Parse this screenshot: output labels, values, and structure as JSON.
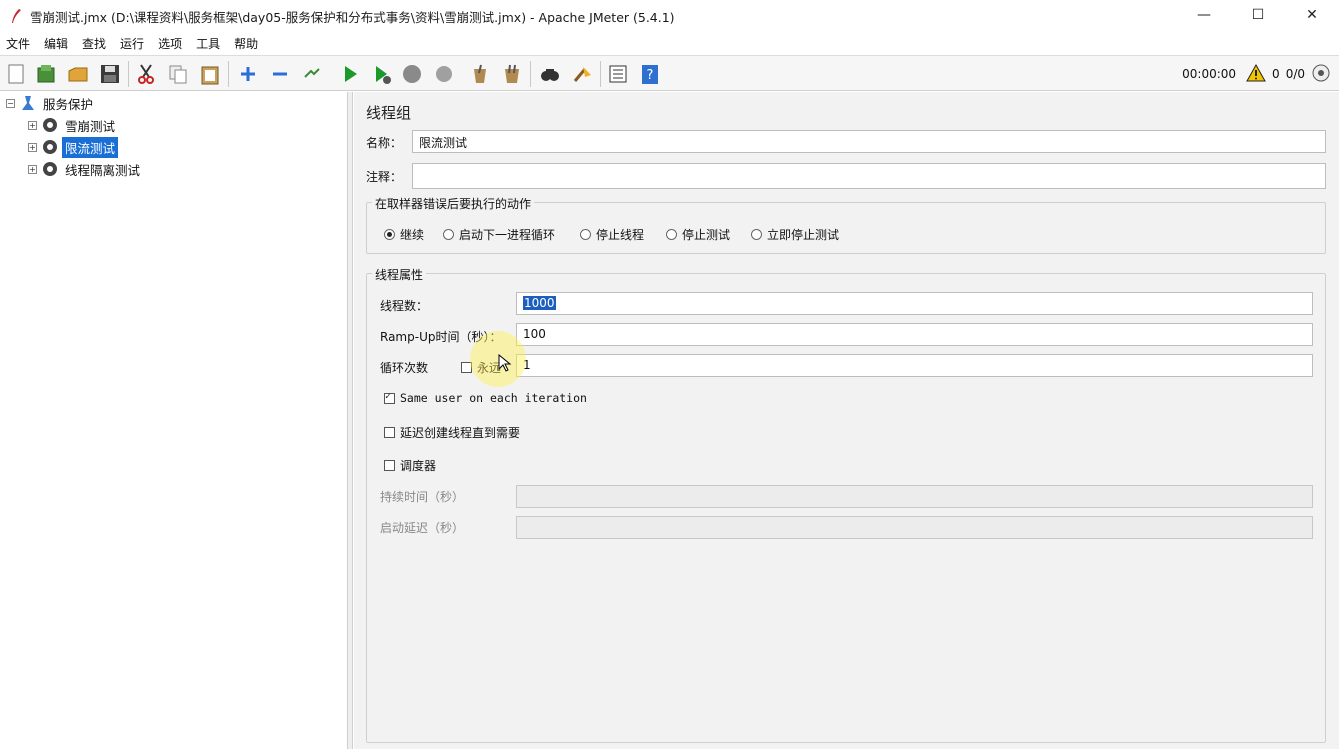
{
  "window": {
    "title": "雪崩测试.jmx (D:\\课程资料\\服务框架\\day05-服务保护和分布式事务\\资料\\雪崩测试.jmx) - Apache JMeter (5.4.1)",
    "controls": [
      "—",
      "☐",
      "✕"
    ]
  },
  "menu": [
    "文件",
    "编辑",
    "查找",
    "运行",
    "选项",
    "工具",
    "帮助"
  ],
  "toolbar": {
    "icons": [
      "new-icon",
      "templates-icon",
      "open-icon",
      "save-icon",
      "cut-icon",
      "copy-icon",
      "paste-icon",
      "expand-icon",
      "collapse-icon",
      "toggle-icon",
      "start-icon",
      "start-no-pause-icon",
      "stop-icon",
      "shutdown-icon",
      "clear-icon",
      "clear-all-icon",
      "search-icon",
      "reset-search-icon",
      "function-helper-icon",
      "help-icon"
    ],
    "timer": "00:00:00",
    "warn_count": "0",
    "threads": "0/0"
  },
  "tree": {
    "root": "服务保护",
    "children": [
      {
        "label": "雪崩测试",
        "selected": false
      },
      {
        "label": "限流测试",
        "selected": true
      },
      {
        "label": "线程隔离测试",
        "selected": false
      }
    ]
  },
  "panel": {
    "title": "线程组",
    "name_label": "名称：",
    "name_value": "限流测试",
    "comment_label": "注释：",
    "comment_value": "",
    "error_group_title": "在取样器错误后要执行的动作",
    "error_actions": [
      {
        "label": "继续",
        "checked": true
      },
      {
        "label": "启动下一进程循环",
        "checked": false
      },
      {
        "label": "停止线程",
        "checked": false
      },
      {
        "label": "停止测试",
        "checked": false
      },
      {
        "label": "立即停止测试",
        "checked": false
      }
    ],
    "thread_group_title": "线程属性",
    "threads_label": "线程数：",
    "threads_value": "1000",
    "rampup_label": "Ramp-Up时间（秒）：",
    "rampup_value": "100",
    "loop_label": "循环次数",
    "forever_label": "永远",
    "loop_value": "1",
    "same_user_label": "Same user on each iteration",
    "delay_label": "延迟创建线程直到需要",
    "scheduler_label": "调度器",
    "duration_label": "持续时间（秒）",
    "duration_value": "",
    "startup_delay_label": "启动延迟（秒）",
    "startup_delay_value": ""
  },
  "colors": {
    "selection": "#1a6fd6",
    "panel_bg": "#f2f2f2",
    "start_green": "#1a9a2a",
    "warn_yellow": "#f2c400"
  }
}
